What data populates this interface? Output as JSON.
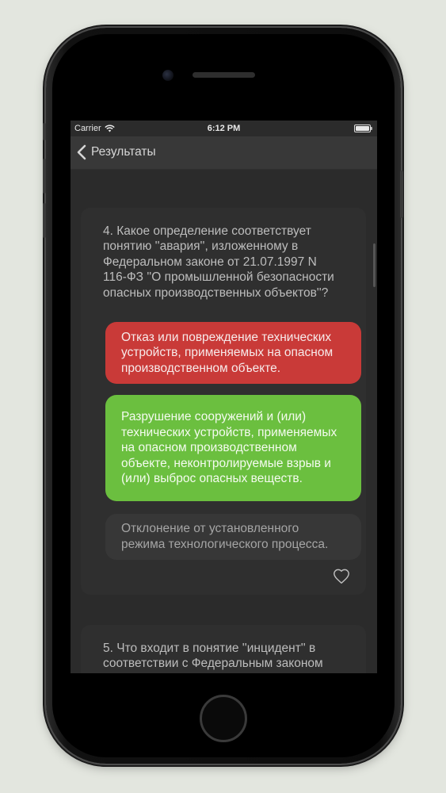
{
  "status_bar": {
    "carrier": "Carrier",
    "time": "6:12 PM"
  },
  "nav": {
    "back_label": "Результаты"
  },
  "questions": [
    {
      "text": "4. Какое определение соответствует понятию ''авария'', изложенному в Федеральном законе от 21.07.1997 N 116-ФЗ ''О промышленной безопасности опасных производственных объектов''?",
      "answers": [
        {
          "text": "Отказ или повреждение технических устройств, применяемых на опасном производственном объекте.",
          "state": "wrong",
          "color": "#c93a38"
        },
        {
          "text": "Разрушение сооружений и (или) технических устройств, применяемых на опасном производственном объекте, неконтролируемые взрыв и (или) выброс опасных веществ.",
          "state": "correct",
          "color": "#6bbf3f"
        },
        {
          "text": "Отклонение от установленного режима технологического процесса.",
          "state": "neutral",
          "color": "#373737"
        }
      ],
      "favorite_icon": "heart-icon"
    },
    {
      "text": "5. Что входит в понятие ''инцидент'' в соответствии с Федеральным законом"
    }
  ]
}
